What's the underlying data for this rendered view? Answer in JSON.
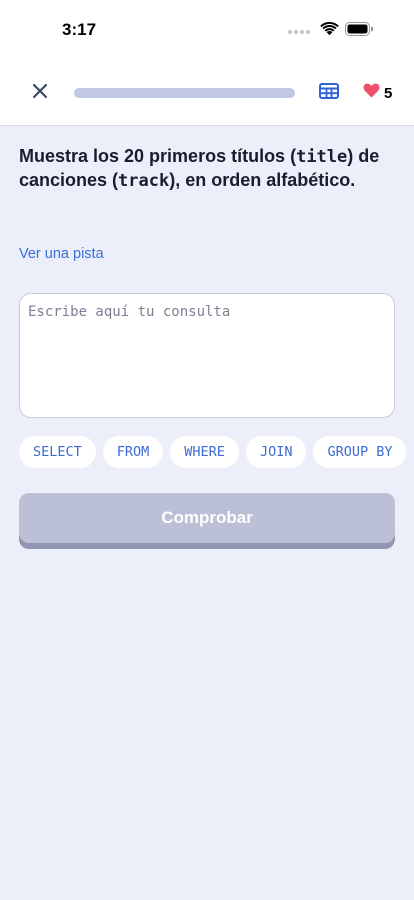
{
  "status_bar": {
    "time": "3:17"
  },
  "top_bar": {
    "progress_fraction": 0.0,
    "lives": "5"
  },
  "exercise": {
    "prompt_part1": "Muestra los 20 primeros títulos (",
    "prompt_code1": "title",
    "prompt_part2": ") de canciones (",
    "prompt_code2": "track",
    "prompt_part3": "), en orden alfabético.",
    "hint_label": "Ver una pista",
    "query_placeholder": "Escribe aquí tu consulta",
    "query_value": ""
  },
  "keywords": [
    "SELECT",
    "FROM",
    "WHERE",
    "JOIN",
    "GROUP BY"
  ],
  "actions": {
    "check_label": "Comprobar"
  },
  "colors": {
    "accent": "#3a6fd8",
    "background": "#eceef9",
    "heart": "#f0506e",
    "button_disabled": "#bbc0d6"
  },
  "icons": {
    "close": "close-icon",
    "table": "table-icon",
    "heart": "heart-icon",
    "wifi": "wifi-icon",
    "battery": "battery-icon"
  }
}
